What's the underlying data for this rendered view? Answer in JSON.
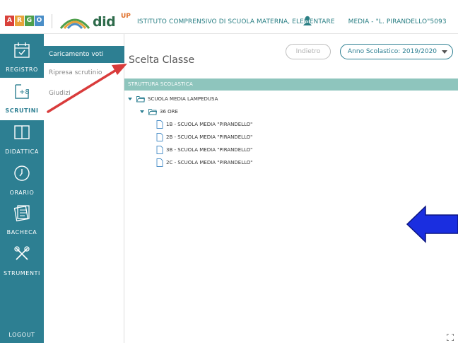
{
  "header": {
    "argo_letters": [
      "A",
      "R",
      "G",
      "O"
    ],
    "argo_colors": [
      "#d9413a",
      "#e7a33a",
      "#4e9f4b",
      "#4a8ec7"
    ],
    "didup_text": "did",
    "didup_sup": "UP",
    "school_prefix": "ISTITUTO COMPRENSIVO DI SCUOLA MATERNA, ELEMENTARE ",
    "school_suffix": "MEDIA - \"L. PIRANDELLO\"5093"
  },
  "rail": {
    "items": [
      {
        "label": "REGISTRO",
        "icon": "calendar-check-icon"
      },
      {
        "label": "SCRUTINI",
        "icon": "grade-icon"
      },
      {
        "label": "DIDATTICA",
        "icon": "book-icon"
      },
      {
        "label": "ORARIO",
        "icon": "clock-icon"
      },
      {
        "label": "BACHECA",
        "icon": "noticeboard-icon"
      },
      {
        "label": "STRUMENTI",
        "icon": "tools-icon"
      }
    ],
    "grade_glyph": "+8",
    "logout": "LOGOUT"
  },
  "submenu": {
    "items": [
      "Caricamento voti",
      "Ripresa scrutinio",
      "Giudizi"
    ]
  },
  "main": {
    "title": "Scelta Classe",
    "back_button": "Indietro",
    "year_selector": "Anno Scolastico: 2019/2020",
    "tree_header": "STRUTTURA SCOLASTICA",
    "tree": {
      "school": "SCUOLA MEDIA LAMPEDUSA",
      "group": "36 ORE",
      "classes": [
        "1B - SCUOLA MEDIA \"PIRANDELLO\"",
        "2B - SCUOLA MEDIA \"PIRANDELLO\"",
        "3B - SCUOLA MEDIA \"PIRANDELLO\"",
        "2C - SCUOLA MEDIA \"PIRANDELLO\""
      ]
    }
  },
  "colors": {
    "accent": "#2d7f92",
    "tree_header": "#8ec5bd",
    "annotation_red": "#d93b3b",
    "annotation_blue": "#1a2ee0"
  }
}
